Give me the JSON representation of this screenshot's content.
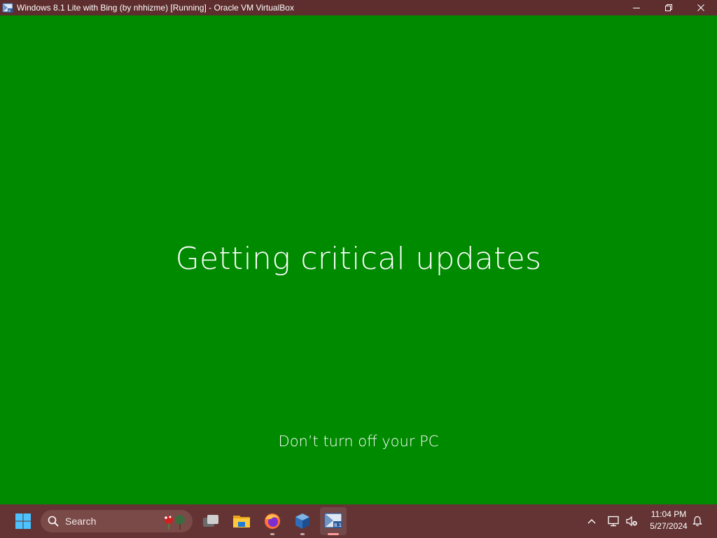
{
  "window": {
    "title": "Windows 8.1 Lite with Bing (by nhhizme) [Running] - Oracle VM VirtualBox",
    "icon": "virtualbox-vm-icon",
    "controls": [
      "minimize-icon",
      "restore-icon",
      "close-icon"
    ]
  },
  "vm_screen": {
    "background": "#008a00",
    "headline": "Getting critical updates",
    "subline": "Don’t turn off your PC"
  },
  "taskbar": {
    "background": "#643434",
    "start_icon": "windows-start-icon",
    "search": {
      "label": "Search",
      "icon": "search-icon"
    },
    "apps": [
      {
        "name": "task-view",
        "icon": "task-view-icon",
        "running": false
      },
      {
        "name": "file-explorer",
        "icon": "folder-icon",
        "running": false
      },
      {
        "name": "firefox",
        "icon": "firefox-icon",
        "running": true
      },
      {
        "name": "virtualbox-manager",
        "icon": "virtualbox-icon",
        "running": true
      },
      {
        "name": "virtualbox-vm",
        "icon": "virtualbox-vm-icon",
        "running": true,
        "active": true
      }
    ],
    "tray": {
      "icons": [
        "chevron-up-icon",
        "network-icon",
        "volume-muted-icon",
        "notification-bell-icon"
      ],
      "time": "11:04 PM",
      "date": "5/27/2024"
    }
  }
}
